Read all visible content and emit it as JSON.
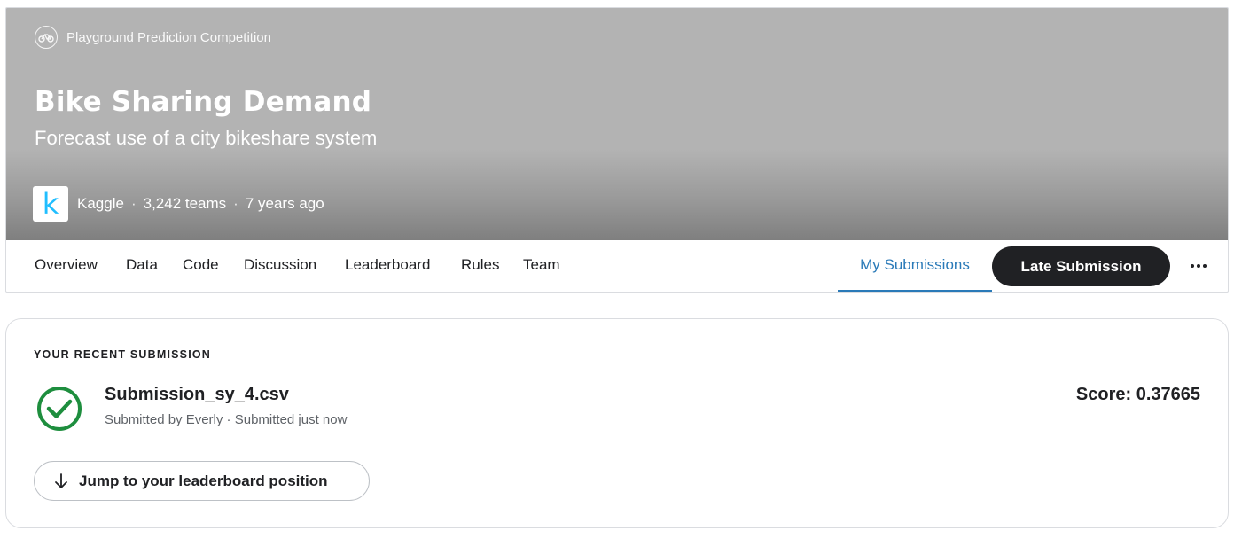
{
  "competition": {
    "type_label": "Playground Prediction Competition",
    "type_icon": "bike-icon",
    "title": "Bike Sharing Demand",
    "subtitle": "Forecast use of a city bikeshare system",
    "host_logo_letter": "k",
    "host": "Kaggle",
    "teams": "3,242 teams",
    "age": "7 years ago",
    "separator": "·"
  },
  "nav": {
    "tabs": [
      {
        "label": "Overview"
      },
      {
        "label": "Data"
      },
      {
        "label": "Code"
      },
      {
        "label": "Discussion"
      },
      {
        "label": "Leaderboard"
      },
      {
        "label": "Rules"
      },
      {
        "label": "Team"
      }
    ],
    "active_tab": "My Submissions",
    "late_submission_label": "Late Submission",
    "more_icon": "more-horizontal-icon"
  },
  "recent_submission": {
    "section_label": "YOUR RECENT SUBMISSION",
    "status_icon": "check-circle-icon",
    "file_name": "Submission_sy_4.csv",
    "meta": "Submitted by Everly · Submitted just now",
    "score": "Score: 0.37665",
    "jump_label": "Jump to your leaderboard position",
    "jump_icon": "arrow-down-icon"
  },
  "colors": {
    "accent_blue": "#2a7ab8",
    "success_green": "#1e8e3e",
    "dark_button": "#202124",
    "kaggle_blue": "#20beff"
  }
}
